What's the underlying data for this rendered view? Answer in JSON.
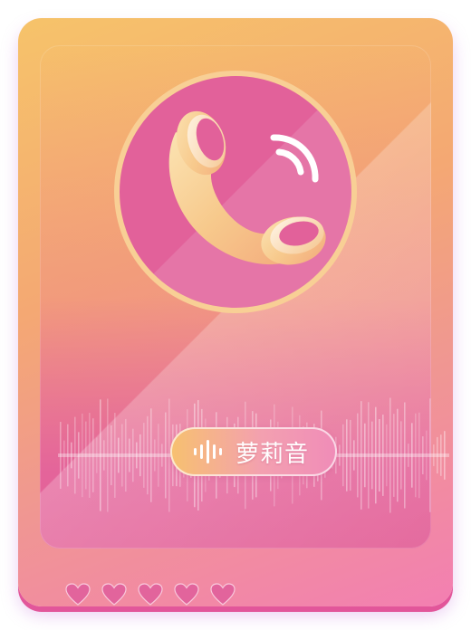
{
  "voice_tag": {
    "label": "萝莉音",
    "icon": "sound-wave-icon"
  },
  "call_icon": "phone-call-icon",
  "rating": {
    "value": 5,
    "max": 5,
    "icon": "heart-icon"
  },
  "colors": {
    "card_top": "#f6c36a",
    "card_bottom": "#f37fb2",
    "disc": "#e2619a",
    "handset": "#f7cf94",
    "heart": "#e2649c"
  }
}
